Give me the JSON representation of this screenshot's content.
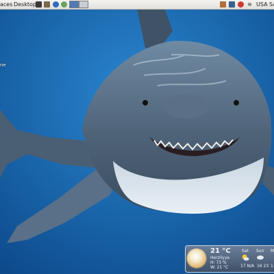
{
  "top_panel": {
    "places_label": "aces",
    "desktop_label": "Desktop",
    "keyboard_layout": "USA",
    "user_fragment": "Sa"
  },
  "desktop": {
    "icon_label_fragment": "ne"
  },
  "weather_widget": {
    "temperature": "21 °C",
    "city": "Herzliyya",
    "humidity": "H: 73 %",
    "wind": "W: 21 °C",
    "forecast": [
      {
        "day": "Sat",
        "temps": "17 N/A"
      },
      {
        "day": "Sun",
        "temps": "16 23"
      },
      {
        "day": "M",
        "temps": "1"
      }
    ]
  },
  "colors": {
    "ocean_deep": "#0d4a8c",
    "ocean_light": "#2a86cf",
    "shark_gray": "#4f6378"
  }
}
